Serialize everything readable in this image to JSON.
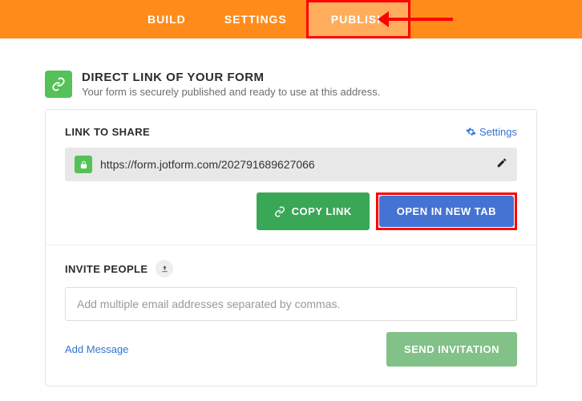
{
  "tabs": {
    "build": "BUILD",
    "settings": "SETTINGS",
    "publish": "PUBLISH"
  },
  "section": {
    "title": "DIRECT LINK OF YOUR FORM",
    "subtitle": "Your form is securely published and ready to use at this address."
  },
  "share": {
    "label": "LINK TO SHARE",
    "settings": "Settings",
    "url": "https://form.jotform.com/202791689627066",
    "copy": "COPY LINK",
    "open": "OPEN IN NEW TAB"
  },
  "invite": {
    "label": "INVITE PEOPLE",
    "placeholder": "Add multiple email addresses separated by commas.",
    "add_message": "Add Message",
    "send": "SEND INVITATION"
  }
}
